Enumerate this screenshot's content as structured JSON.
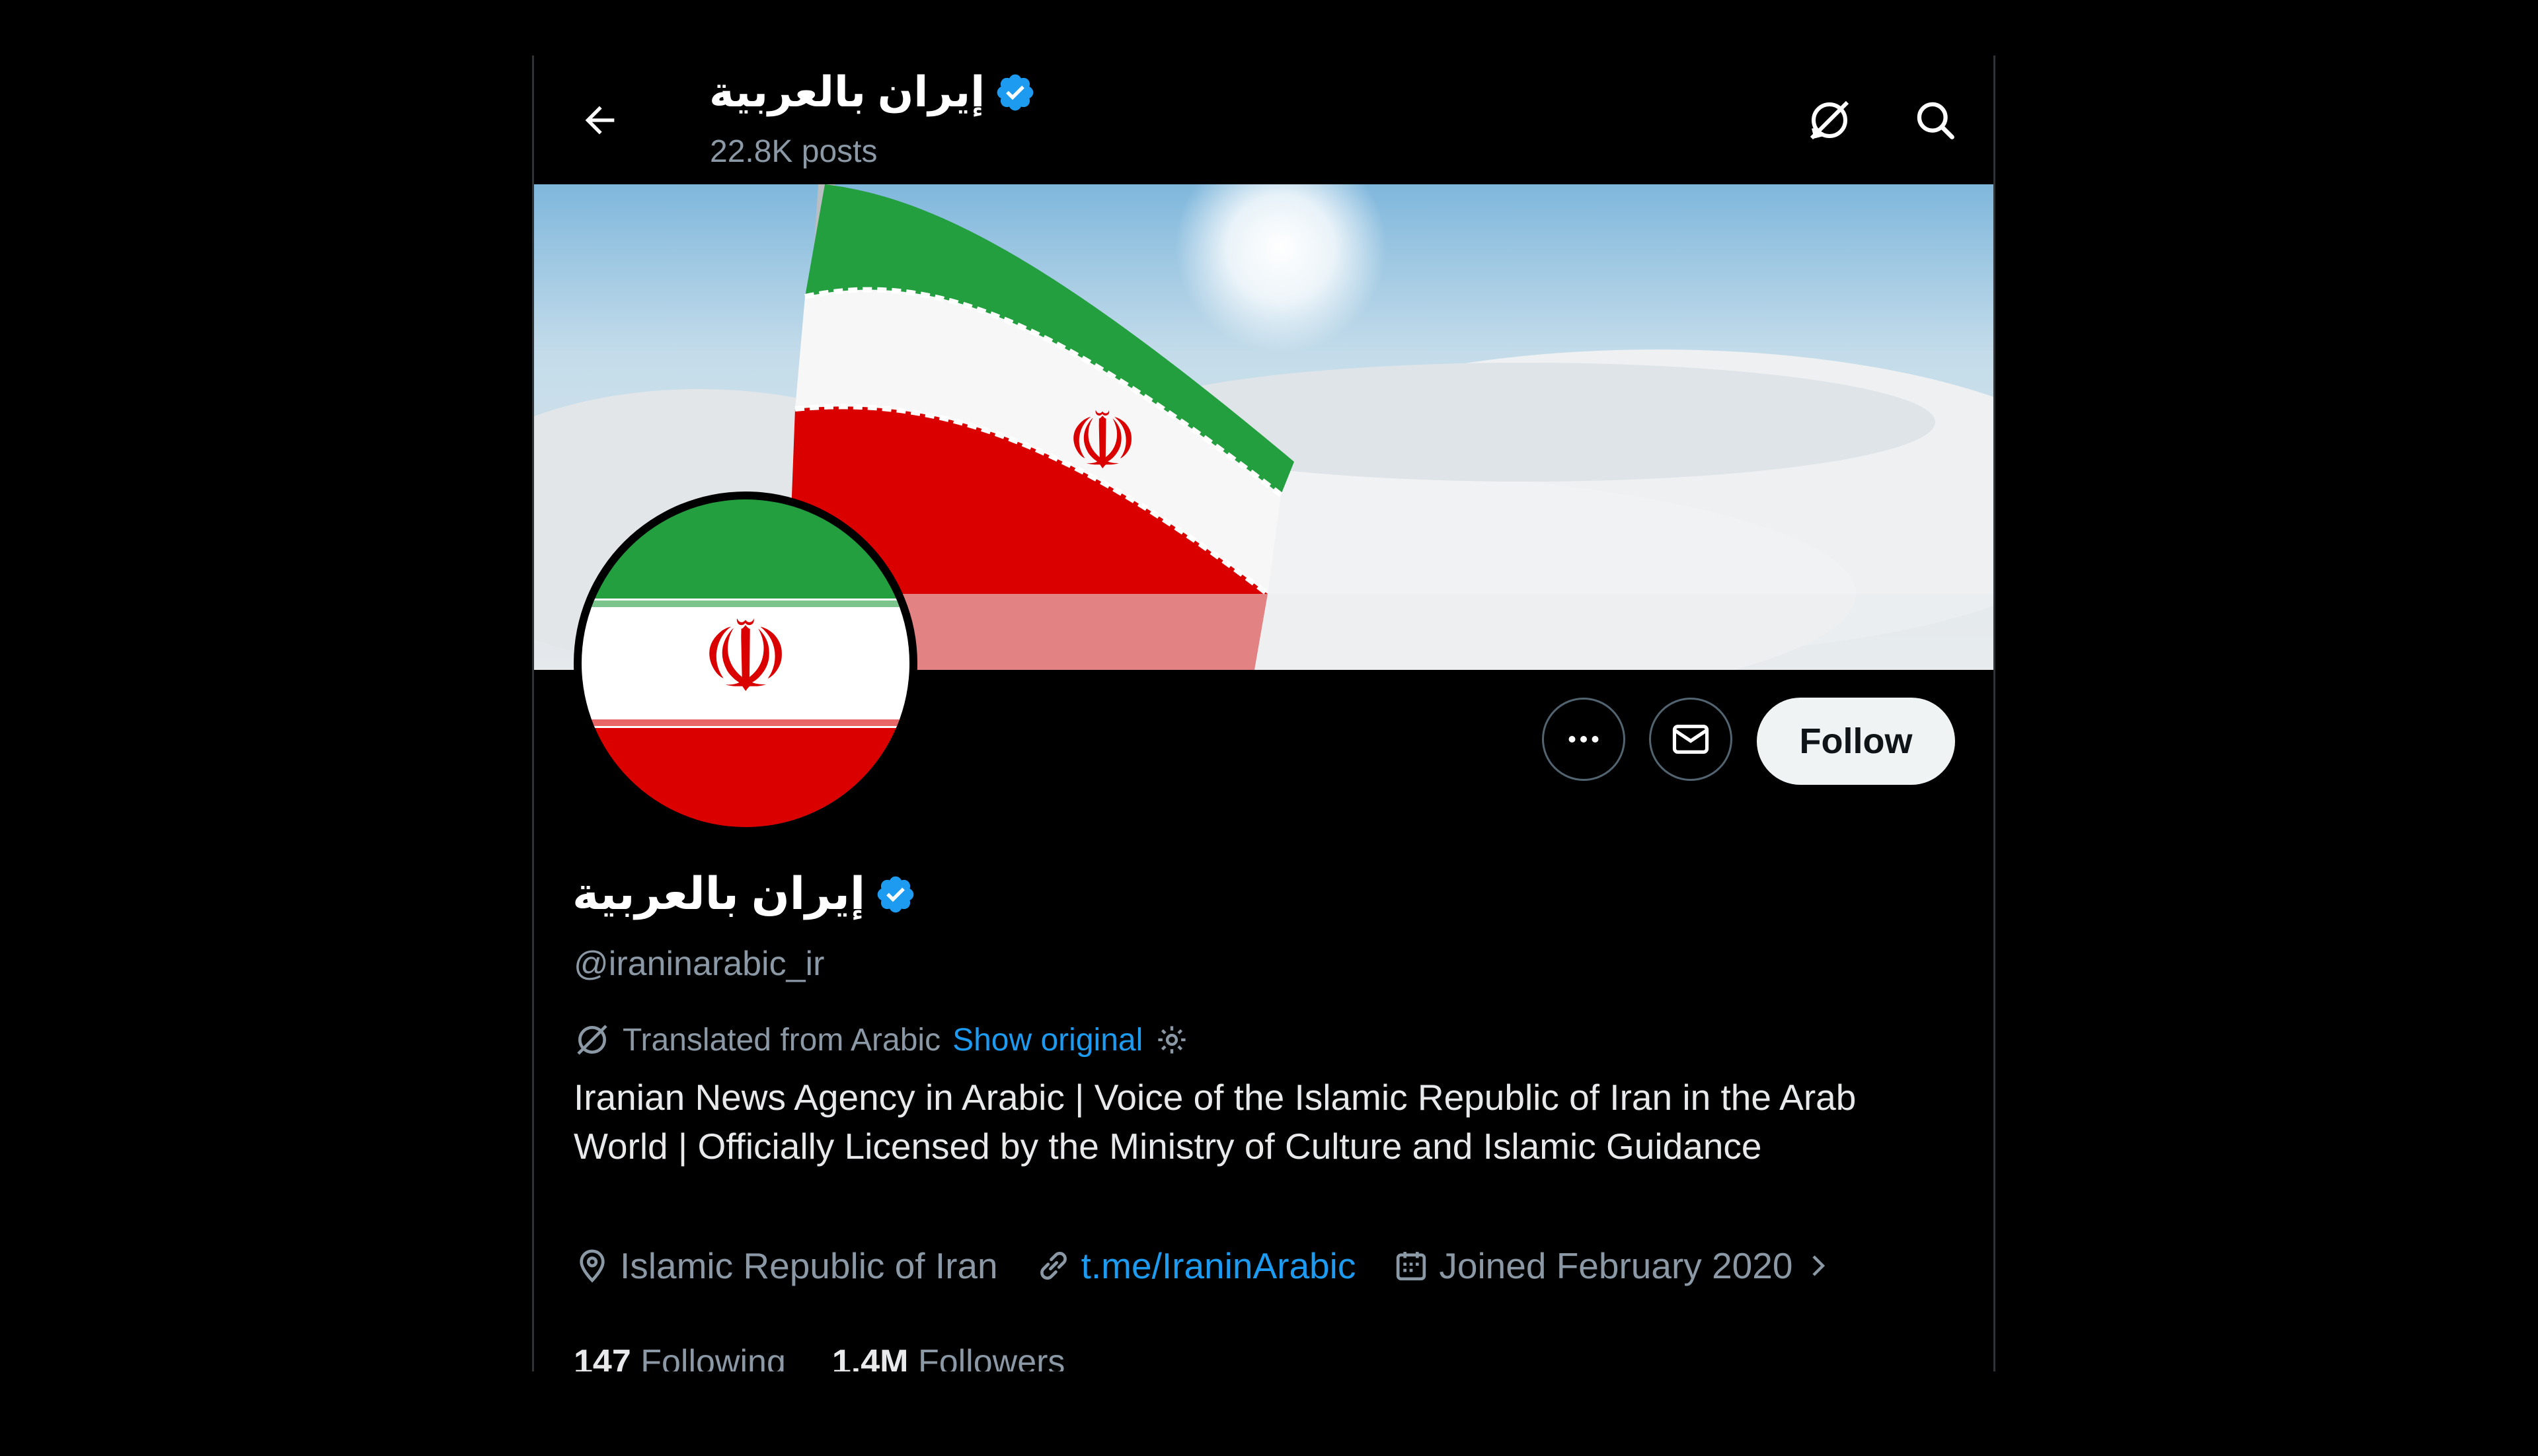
{
  "header": {
    "name": "إيران بالعربية",
    "posts": "22.8K posts"
  },
  "profile": {
    "name": "إيران بالعربية",
    "handle": "@iraninarabic_ir",
    "translated_label": "Translated from Arabic",
    "show_original": "Show original",
    "bio": "Iranian News Agency in Arabic | Voice of the Islamic Republic of Iran in the Arab World | Officially Licensed by the Ministry of Culture and Islamic Guidance",
    "location": "Islamic Republic of Iran",
    "website": "t.me/IraninArabic",
    "joined": "Joined February 2020"
  },
  "actions": {
    "follow_label": "Follow"
  },
  "stats": {
    "following_count": "147",
    "following_label": "Following",
    "followers_count": "1.4M",
    "followers_label": "Followers"
  },
  "colors": {
    "accent": "#1d9bf0",
    "flag_green": "#239f40",
    "flag_red": "#da0000"
  }
}
